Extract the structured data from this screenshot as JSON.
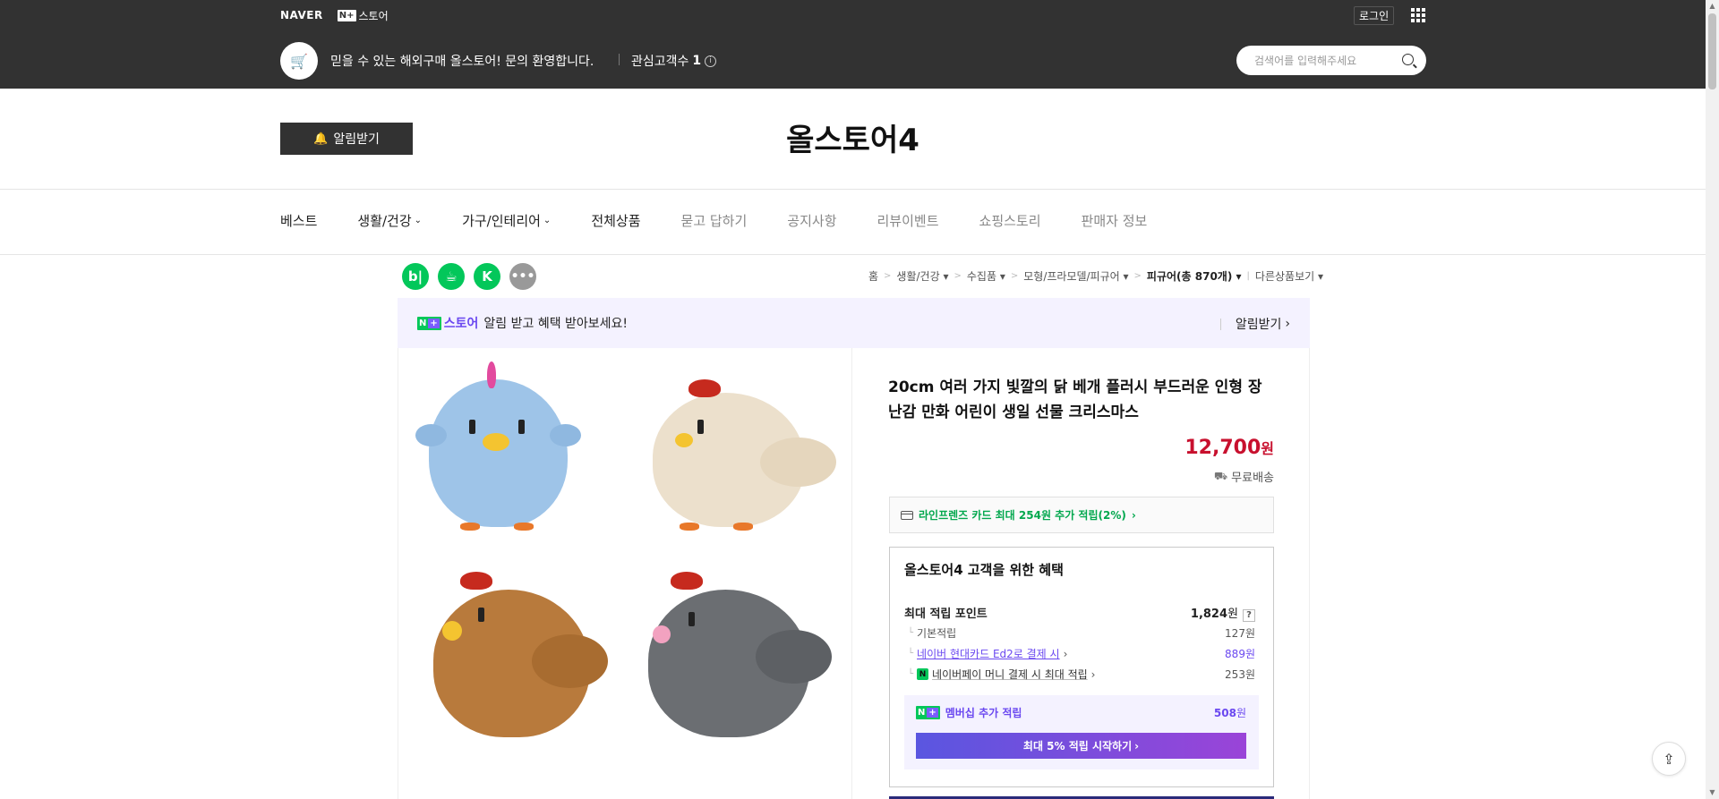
{
  "top": {
    "naver_logo": "NAVER",
    "nstore_mark": "N+",
    "nstore_label": "스토어",
    "login": "로그인",
    "store_desc": "믿을 수 있는 해외구매 올스토어! 문의 환영합니다.",
    "interest_label": "관심고객수",
    "interest_count": "1",
    "search_placeholder": "검색어를 입력해주세요"
  },
  "header": {
    "alarm_label": "알림받기",
    "store_title": "올스토어4"
  },
  "nav": [
    {
      "label": "베스트",
      "dim": false,
      "dropdown": false
    },
    {
      "label": "생활/건강",
      "dim": false,
      "dropdown": true
    },
    {
      "label": "가구/인테리어",
      "dim": false,
      "dropdown": true
    },
    {
      "label": "전체상품",
      "dim": false,
      "dropdown": false
    },
    {
      "label": "묻고 답하기",
      "dim": true,
      "dropdown": false
    },
    {
      "label": "공지사항",
      "dim": true,
      "dropdown": false
    },
    {
      "label": "리뷰이벤트",
      "dim": true,
      "dropdown": false
    },
    {
      "label": "쇼핑스토리",
      "dim": true,
      "dropdown": false
    },
    {
      "label": "판매자 정보",
      "dim": true,
      "dropdown": false
    }
  ],
  "share": {
    "blog": "b|",
    "cafe": "☕",
    "keep": "K",
    "more": "•••"
  },
  "breadcrumb": {
    "home": "홈",
    "c1": "생활/건강",
    "c2": "수집품",
    "c3": "모형/프라모델/피규어",
    "c4": "피규어(총 870개)",
    "other": "다른상품보기"
  },
  "notify": {
    "n_mark": "N",
    "plus_mark": "+",
    "store": "스토어",
    "text": "알림 받고 혜택 받아보세요!",
    "right": "알림받기"
  },
  "product": {
    "title": "20cm 여러 가지 빛깔의 닭 베개 플러시 부드러운 인형 장난감 만화 어린이 생일 선물 크리스마스",
    "price": "12,700",
    "won": "원",
    "shipping": "무료배송",
    "card_text": "라인프렌즈 카드 최대 254원 추가 적립(2%)"
  },
  "benefit": {
    "title": "올스토어4 고객을 위한 혜택",
    "max_label": "최대 적립 포인트",
    "max_value": "1,824",
    "basic_label": "기본적립",
    "basic_value": "127원",
    "hyundai_label": "네이버 현대카드 Ed2로 결제 시",
    "hyundai_value": "889원",
    "npay_label": "네이버페이 머니 결제 시 최대 적립",
    "npay_value": "253원",
    "member_label": "멤버십 추가 적립",
    "member_value": "508",
    "member_btn": "최대 5% 적립 시작하기"
  },
  "colors": {
    "topbar": "#323232",
    "price": "#c8102e",
    "naver_green": "#03c75a",
    "purple": "#6a48f0"
  },
  "icons": {
    "search": "search-icon",
    "apps": "apps-grid-icon",
    "bell": "bell-icon",
    "info": "info-icon",
    "truck": "truck-icon",
    "card": "credit-card-icon",
    "share": "share-icon"
  }
}
